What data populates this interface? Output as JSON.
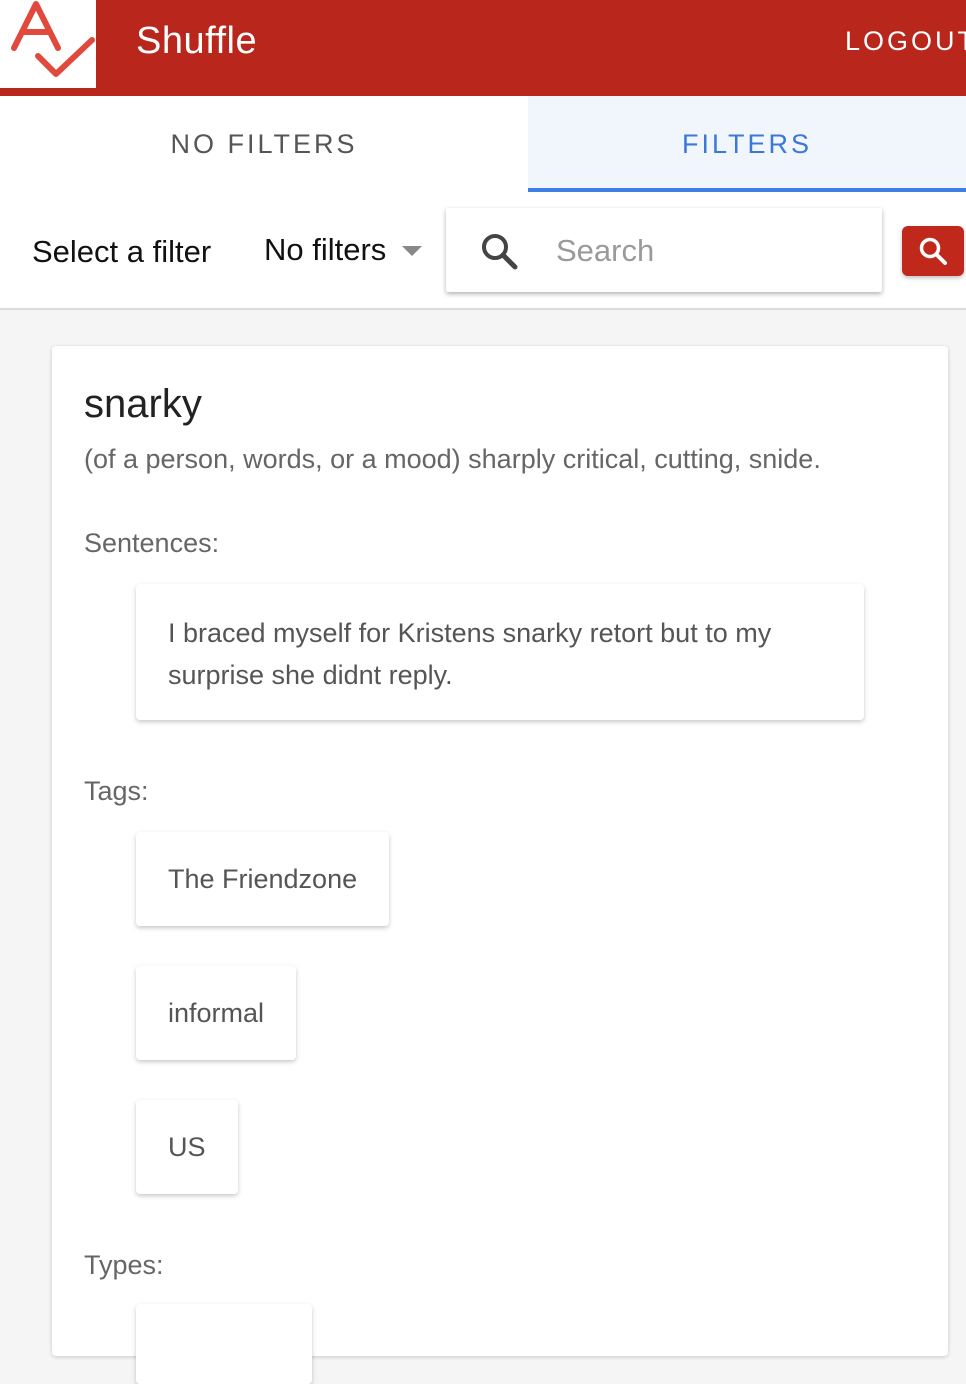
{
  "header": {
    "title": "Shuffle",
    "logout_label": "LOGOUT",
    "brand_color": "#b9261c"
  },
  "tabs": [
    {
      "label": "NO FILTERS",
      "active": false
    },
    {
      "label": "FILTERS",
      "active": true
    }
  ],
  "filter_bar": {
    "label": "Select a filter",
    "selected_filter": "No filters",
    "search_placeholder": "Search",
    "search_value": ""
  },
  "word_card": {
    "word": "snarky",
    "definition": "(of a person, words, or a mood) sharply critical, cutting, snide.",
    "sentences_label": "Sentences:",
    "sentences": [
      "I braced myself for Kristens snarky retort but to my surprise she didnt reply."
    ],
    "tags_label": "Tags:",
    "tags": [
      "The Friendzone",
      "informal",
      "US"
    ],
    "types_label": "Types:"
  },
  "icons": [
    "logo-icon",
    "search-icon",
    "search-button-icon",
    "dropdown-caret-icon"
  ]
}
